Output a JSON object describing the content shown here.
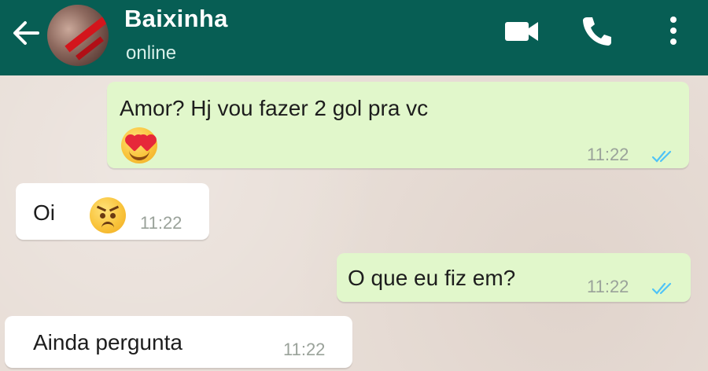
{
  "header": {
    "contact_name": "Baixinha",
    "status": "online",
    "icons": [
      "back-arrow-icon",
      "video-call-icon",
      "phone-icon",
      "more-vert-icon"
    ],
    "color": "#075e54"
  },
  "messages": [
    {
      "direction": "outgoing",
      "text": "Amor? Hj vou fazer 2 gol pra vc",
      "emoji": "smiling-face-with-heart-eyes",
      "time": "11:22",
      "read": true
    },
    {
      "direction": "incoming",
      "text": "Oi",
      "emoji": "angry-face",
      "time": "11:22"
    },
    {
      "direction": "outgoing",
      "text": "O que eu fiz em?",
      "time": "11:22",
      "read": true
    },
    {
      "direction": "incoming",
      "text": "Ainda pergunta",
      "time": "11:22"
    }
  ],
  "colors": {
    "outgoing_bubble": "#e1f7cb",
    "incoming_bubble": "#ffffff",
    "read_ticks": "#4fc3f7"
  }
}
